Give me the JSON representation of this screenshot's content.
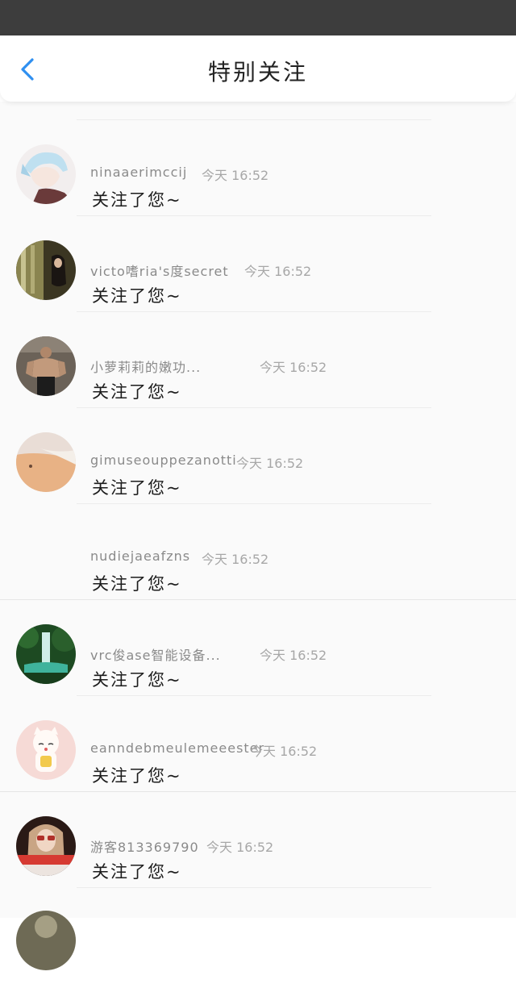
{
  "header": {
    "title": "特别关注"
  },
  "notifications": [
    {
      "name": "ninaaerimccij",
      "time": "今天 16:52",
      "message": "关注了您~",
      "avatar": "anime-boy-avatar"
    },
    {
      "name": "victo嗜ria's度secret",
      "time": "今天 16:52",
      "message": "关注了您~",
      "avatar": "woman-window-avatar"
    },
    {
      "name": "小萝莉莉的嫩功...",
      "time": "今天 16:52",
      "message": "关注了您~",
      "avatar": "muscle-man-avatar"
    },
    {
      "name": "gimuseouppezanotti",
      "time": "今天 16:52",
      "message": "关注了您~",
      "avatar": "beach-avatar"
    },
    {
      "name": "nudiejaeafzns",
      "time": "今天 16:52",
      "message": "关注了您~",
      "avatar": ""
    },
    {
      "name": "vrc俊ase智能设备...",
      "time": "今天 16:52",
      "message": "关注了您~",
      "avatar": "waterfall-avatar"
    },
    {
      "name": "eanndebmeulemeeester",
      "time": "今天 16:52",
      "message": "关注了您~",
      "avatar": "lucky-cat-avatar"
    },
    {
      "name": "游客813369790",
      "time": "今天 16:52",
      "message": "关注了您~",
      "avatar": "girl-sunglasses-avatar"
    }
  ]
}
